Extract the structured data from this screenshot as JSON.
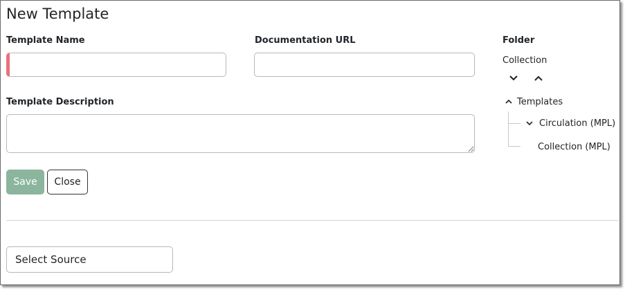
{
  "header": {
    "title": "New Template"
  },
  "form": {
    "template_name": {
      "label": "Template Name",
      "value": "",
      "placeholder": ""
    },
    "documentation_url": {
      "label": "Documentation URL",
      "value": "",
      "placeholder": ""
    },
    "template_description": {
      "label": "Template Description",
      "value": "",
      "placeholder": ""
    }
  },
  "folder": {
    "label": "Folder",
    "selected": "Collection",
    "tree": {
      "root": {
        "label": "Templates",
        "expanded": true
      },
      "children": [
        {
          "label": "Circulation (MPL)",
          "expanded": false
        },
        {
          "label": "Collection (MPL)"
        }
      ]
    }
  },
  "actions": {
    "save_label": "Save",
    "close_label": "Close"
  },
  "source": {
    "label": "Select Source"
  },
  "icons": {
    "expand_all": "chevron-down-icon",
    "collapse_all": "chevron-up-icon",
    "root_toggle": "chevron-up-icon",
    "child_toggle": "chevron-down-icon"
  },
  "colors": {
    "save_button": "#8bb59d",
    "invalid_marker": "#e8727a",
    "text": "#212529"
  }
}
